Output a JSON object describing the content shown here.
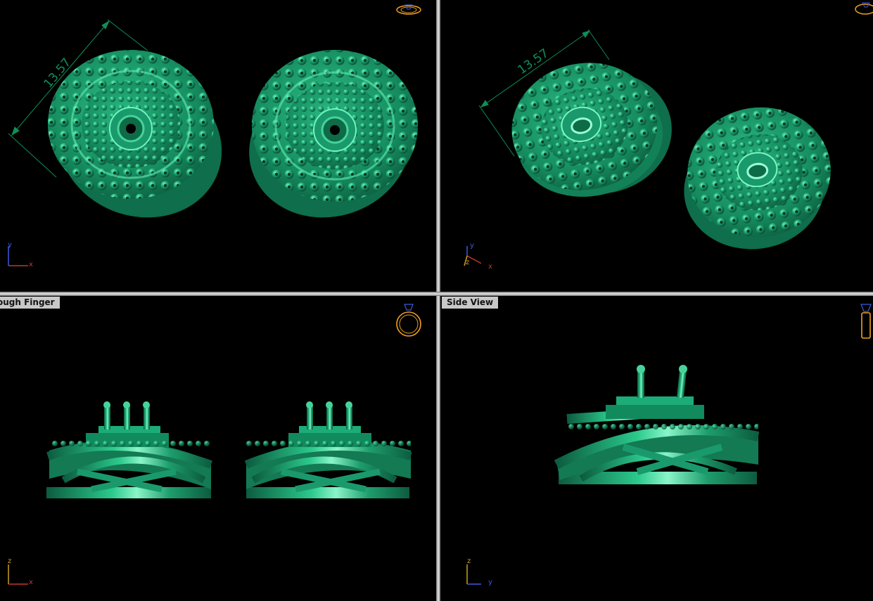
{
  "viewports": {
    "top_left": {
      "label": "",
      "dimension": "13.57",
      "axis": {
        "vertical": "y",
        "horizontal": "x"
      }
    },
    "top_right": {
      "label": "",
      "dimension": "13.57",
      "axis": {
        "vertical": "y",
        "depth": "z",
        "horizontal": "x"
      }
    },
    "bottom_left": {
      "label": "Through Finger",
      "label_visible": "ough Finger",
      "axis": {
        "vertical": "z",
        "horizontal": "x"
      }
    },
    "bottom_right": {
      "label": "Side View",
      "axis": {
        "vertical": "z",
        "horizontal": "y"
      }
    }
  },
  "colors": {
    "model": "#1a9a6c",
    "model_light": "#46d39a",
    "model_dark": "#0a4a33",
    "dimension": "#0f8e58",
    "background": "#000000",
    "label_bg": "#c8c8c8",
    "view_icon": "#f0a020",
    "axis_x": "#c0392b",
    "axis_y": "#3b5bdb",
    "axis_z": "#c8a020"
  },
  "icons": [
    "ring-top-view-icon",
    "ring-perspective-view-icon",
    "ring-front-view-icon",
    "ring-side-view-icon"
  ]
}
